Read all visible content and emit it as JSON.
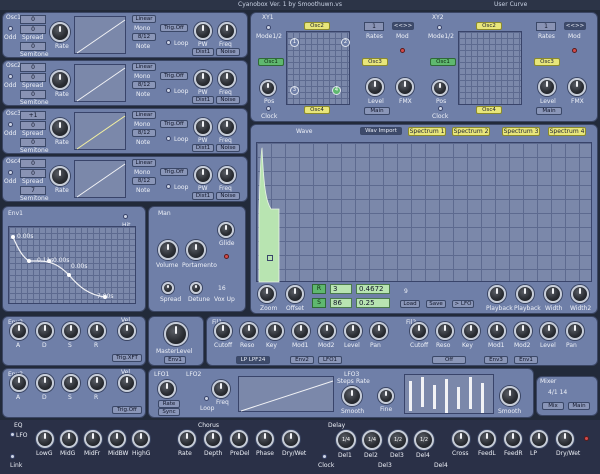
{
  "window": {
    "title": "Cyanobox Ver. 1 by Smoothuwn.vs",
    "user_menu": "User Curve"
  },
  "oscs": [
    {
      "name": "Osc1",
      "mode": "Odd",
      "val_top": "0",
      "val_mid": "0",
      "val_bot": "0",
      "sub_label": "Spread",
      "semitone": "Semitone",
      "shape": "Linear",
      "sel_a": "Mono",
      "sel_b": "8/12",
      "note_label": "Note",
      "trig": "Trig.Off",
      "loop": "Loop",
      "k1": "Rate",
      "k2": "PW",
      "k3": "Freq",
      "btn1": "Dist1",
      "btn2": "Noise"
    },
    {
      "name": "Osc2",
      "mode": "Odd",
      "val_top": "0",
      "val_mid": "0",
      "val_bot": "0",
      "sub_label": "Spread",
      "semitone": "Semitone",
      "shape": "Linear",
      "sel_a": "Mono",
      "sel_b": "8/12",
      "note_label": "Note",
      "trig": "Trig.Off",
      "loop": "Loop",
      "k1": "Rate",
      "k2": "PW",
      "k3": "Freq",
      "btn1": "Dist1",
      "btn2": "Noise"
    },
    {
      "name": "Osc3",
      "mode": "Odd",
      "val_top": "+1",
      "val_mid": "0",
      "val_bot": "0",
      "sub_label": "Spread",
      "semitone": "Semitone",
      "shape": "Linear",
      "sel_a": "Mono",
      "sel_b": "8/12",
      "note_label": "Note",
      "trig": "Trig.Off",
      "loop": "Loop",
      "k1": "Rate",
      "k2": "PW",
      "k3": "Freq",
      "btn1": "Dist1",
      "btn2": "Noise"
    },
    {
      "name": "Osc4",
      "mode": "Odd",
      "val_top": "0",
      "val_mid": "0",
      "val_bot": "7",
      "sub_label": "Spread",
      "semitone": "Semitone",
      "shape": "Linear",
      "sel_a": "Mono",
      "sel_b": "8/12",
      "note_label": "Note",
      "trig": "Trig.Off",
      "loop": "Loop",
      "k1": "Rate",
      "k2": "PW",
      "k3": "Freq",
      "btn1": "Dist1",
      "btn2": "Noise"
    }
  ],
  "xy1": {
    "title": "XY1",
    "mode": "Mode1/2",
    "osc_top": "Osc2",
    "osc_left": "Osc1",
    "osc_bottom": "Osc4",
    "osc_right": "Osc3",
    "pos": "Pos",
    "clock": "Clock",
    "rate_val": "1",
    "rate": "Rates",
    "mod": "Mod",
    "level": "Level",
    "fmx": "FMX",
    "main": "Main"
  },
  "xy2": {
    "title": "XY2",
    "mode": "Mode1/2",
    "osc_top": "Osc2",
    "osc_left": "Osc1",
    "osc_bottom": "Osc4",
    "osc_right": "Osc3",
    "pos": "Pos",
    "clock": "Clock",
    "rate_val": "1",
    "rate": "Rates",
    "mod": "Mod",
    "level": "Level",
    "fmx": "FMX",
    "main": "Main"
  },
  "spectrum": {
    "title": "Wave",
    "wav_import": "Wav Import",
    "tabs": [
      "Spectrum 1",
      "Spectrum 2",
      "Spectrum 3",
      "Spectrum 4"
    ],
    "k_zoom": "Zoom",
    "k_offset": "Offset",
    "val_a_key": "R",
    "val_a": "3",
    "val_a_num": "0.4672",
    "val_b_key": "S",
    "val_b": "86",
    "val_b_num": "0.25",
    "idx": "9",
    "load": "Load",
    "save": "Save",
    "lfo": "> LFO",
    "k_amp": "Playback",
    "k_wid": "Playback",
    "k_width": "Width",
    "k_width2": "Width2"
  },
  "env1": {
    "title": "Env1",
    "mode": "Hit",
    "pts": [
      "0.00s",
      "0.11s",
      "0.00s",
      "0.00s"
    ],
    "last": "7.00s"
  },
  "man": {
    "title": "Man",
    "k1": "Volume",
    "k2": "Portamento",
    "k3": "Glide",
    "k4": "Spread",
    "k5": "Detune",
    "val": "16",
    "unit": "Vox Up"
  },
  "env2": {
    "title": "Env2",
    "knobs": [
      "A",
      "D",
      "S",
      "R"
    ],
    "vel": "Vel",
    "trig": "Trig.XFT"
  },
  "env3": {
    "title": "Env3",
    "knobs": [
      "A",
      "D",
      "S",
      "R"
    ],
    "vel": "Vel",
    "trig": "Trig.Off"
  },
  "master": {
    "label": "MasterLevel",
    "btn": "Env1"
  },
  "filter1": {
    "title": "Fil1",
    "knobs": [
      "Cutoff",
      "Reso",
      "Key",
      "Mod1",
      "Mod2",
      "Level",
      "Pan"
    ],
    "btn1": "LP LPF24",
    "btn2": "Env2",
    "btn3": "LFO1"
  },
  "filter2": {
    "title": "Fil2",
    "knobs": [
      "Cutoff",
      "Reso",
      "Key",
      "Mod1",
      "Mod2",
      "Level",
      "Pan"
    ],
    "btn1": "Off",
    "btn2": "Env3",
    "btn3": "Env1"
  },
  "lfo1": {
    "title": "LFO1",
    "k1": "Rate",
    "sync": "Sync",
    "loop": "Loop"
  },
  "lfo2": {
    "title": "LFO2",
    "k1": "Freq",
    "amp": "Amp"
  },
  "lfo3": {
    "title": "LFO3",
    "k1": "Smooth",
    "k2": "Fine",
    "k3": "Smooth",
    "mode": "Steps",
    "mode2": "Rate"
  },
  "mix": {
    "title": "Mixer",
    "val": "4/1 14",
    "btn1": "Mix",
    "btn2": "Main"
  },
  "bottom": {
    "eq": "EQ",
    "chorus": "Chorus",
    "delay": "Delay",
    "link": "Link",
    "lfo": "LFO",
    "eq_knobs": [
      "LowG",
      "MidG",
      "MidFr",
      "MidBW",
      "HighG"
    ],
    "ch_knobs": [
      "Rate",
      "Depth",
      "PreDel",
      "Phase",
      "Dry/Wet"
    ],
    "dl_knobs": [
      "Del1",
      "Del2",
      "Del3",
      "Del4"
    ],
    "dl_vals": [
      "1/4",
      "1/4",
      "1/2",
      "1/2"
    ],
    "dl_right": [
      "Cross",
      "FeedL",
      "FeedR",
      "LP",
      "Dry/Wet"
    ],
    "clock": "Clock",
    "sub": "Del3",
    "sub2": "Del4"
  }
}
